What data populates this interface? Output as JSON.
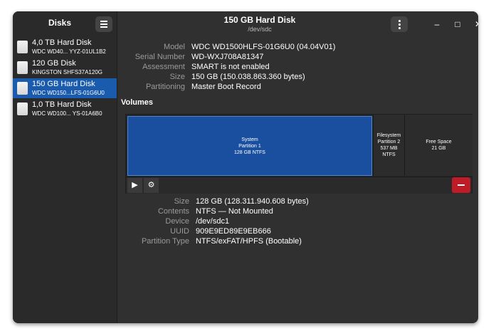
{
  "sidebar": {
    "title": "Disks",
    "disks": [
      {
        "name": "4,0 TB Hard Disk",
        "sub": "WDC WD40... YYZ-01UL1B2"
      },
      {
        "name": "120 GB Disk",
        "sub": "KINGSTON SHFS37A120G"
      },
      {
        "name": "150 GB Hard Disk",
        "sub": "WDC WD150...LFS-01G6U0"
      },
      {
        "name": "1,0 TB Hard Disk",
        "sub": "WDC WD100... YS-01A6B0"
      }
    ]
  },
  "header": {
    "title": "150 GB Hard Disk",
    "subtitle": "/dev/sdc",
    "minimize": "–",
    "maximize": "□",
    "close": "✕"
  },
  "disk_info": {
    "model_label": "Model",
    "model": "WDC WD1500HLFS-01G6U0 (04.04V01)",
    "serial_label": "Serial Number",
    "serial": "WD-WXJ708A81347",
    "assessment_label": "Assessment",
    "assessment": "SMART is not enabled",
    "size_label": "Size",
    "size": "150 GB (150.038.863.360 bytes)",
    "partitioning_label": "Partitioning",
    "partitioning": "Master Boot Record"
  },
  "volumes": {
    "heading": "Volumes",
    "system": {
      "line1": "System",
      "line2": "Partition 1",
      "line3": "128 GB NTFS"
    },
    "filesystem": {
      "line1": "Filesystem",
      "line2": "Partition 2",
      "line3": "537 MB NTFS"
    },
    "free": {
      "line1": "Free Space",
      "line2": "21 GB"
    },
    "play_glyph": "▶",
    "gear_glyph": "⚙"
  },
  "partition_info": {
    "size_label": "Size",
    "size": "128 GB (128.311.940.608 bytes)",
    "contents_label": "Contents",
    "contents": "NTFS — Not Mounted",
    "device_label": "Device",
    "device": "/dev/sdc1",
    "uuid_label": "UUID",
    "uuid": "909E9ED89E9EB666",
    "type_label": "Partition Type",
    "type": "NTFS/exFAT/HPFS (Bootable)"
  },
  "icons": {
    "menu": "hamburger-menu-icon",
    "kebab": "vertical-dots-icon",
    "disk": "hard-disk-icon",
    "remove": "minus-icon"
  },
  "colors": {
    "accent": "#1b5bae",
    "partition": "#1a4fa0",
    "destructive": "#c01c28"
  }
}
